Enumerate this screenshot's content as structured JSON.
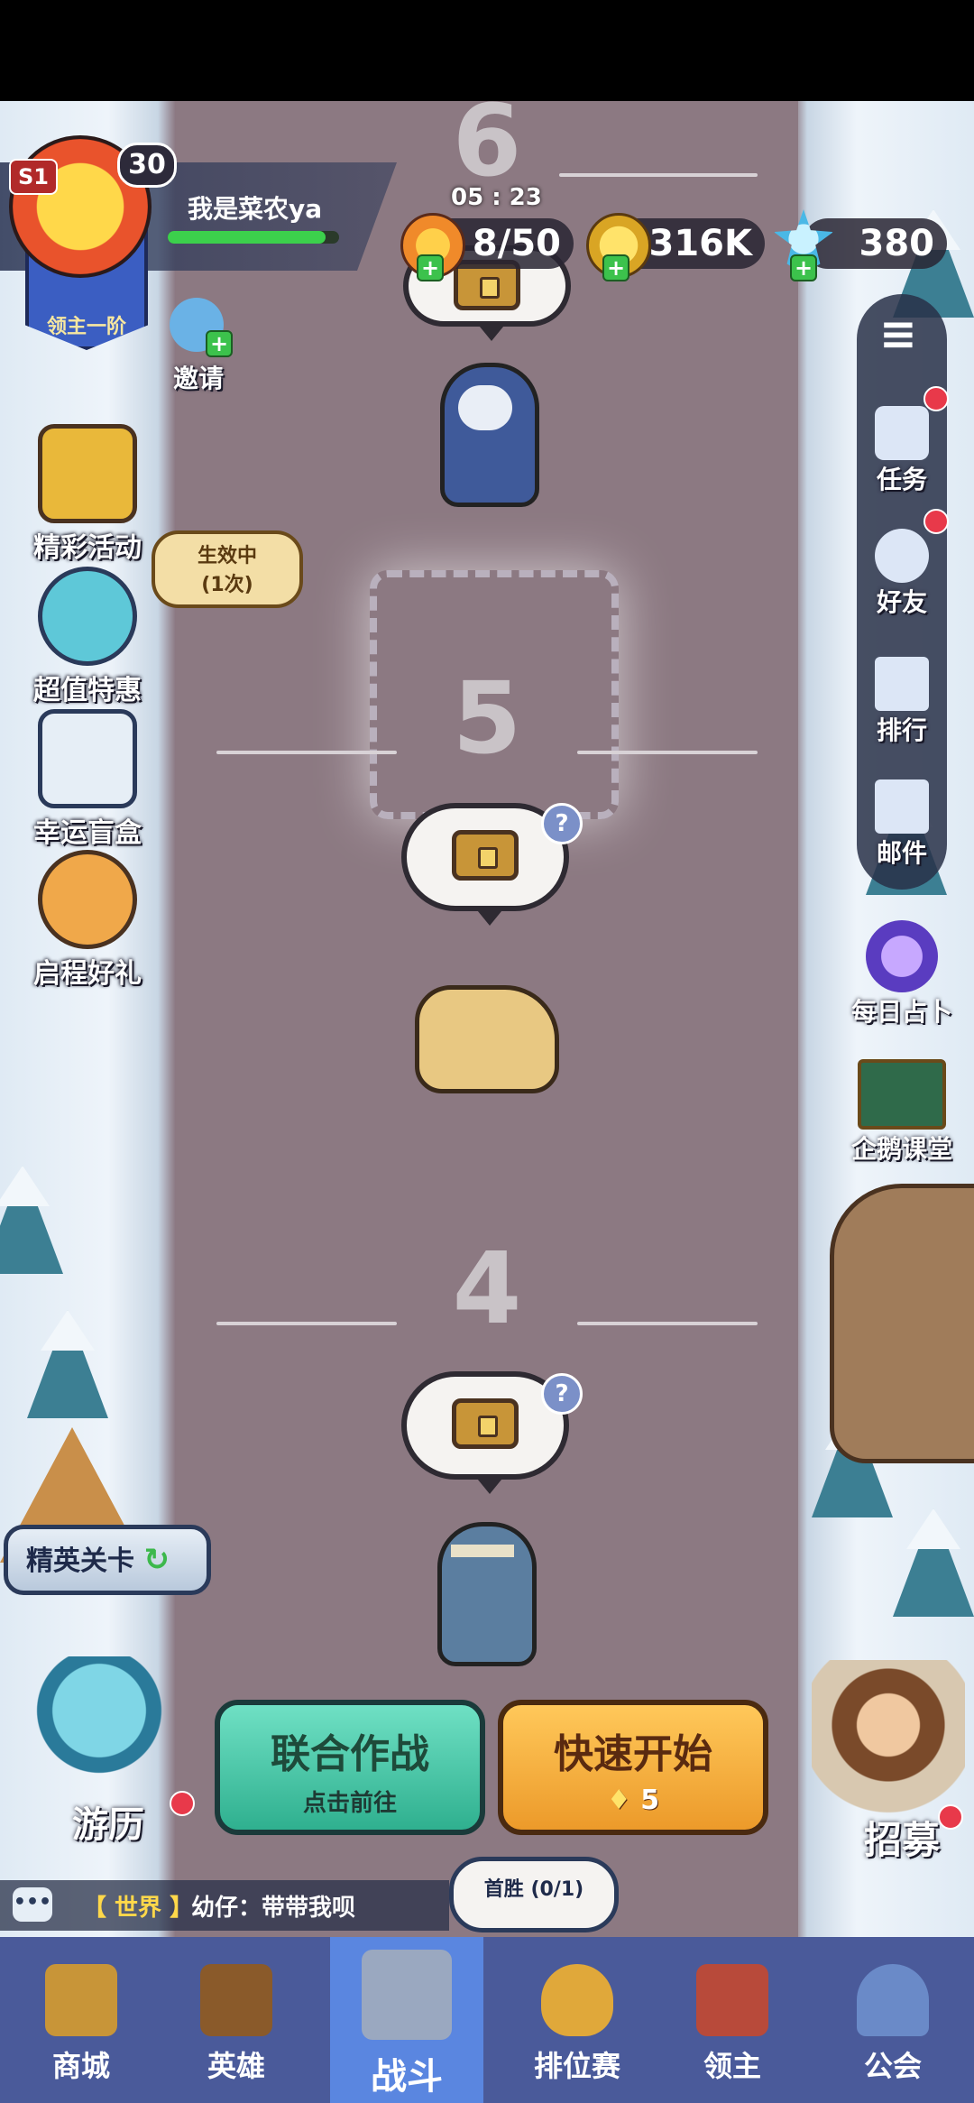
{
  "player": {
    "season": "S1",
    "level": "30",
    "name": "我是菜农ya",
    "rank": "领主一阶",
    "invite": "邀请"
  },
  "timer": "05 : 23",
  "resources": {
    "energy": "8/50",
    "gold": "316K",
    "gems": "380"
  },
  "left_menu": [
    {
      "label": "精彩活动",
      "icon": "chest-icon"
    },
    {
      "label": "超值特惠",
      "icon": "clock-icon"
    },
    {
      "label": "幸运盲盒",
      "icon": "clover-box-icon"
    },
    {
      "label": "启程好礼",
      "icon": "fox-icon"
    }
  ],
  "effect_badge": {
    "title": "生效中",
    "count": "(1次)"
  },
  "right_menu": [
    {
      "label": "任务"
    },
    {
      "label": "好友"
    },
    {
      "label": "排行"
    },
    {
      "label": "邮件"
    },
    {
      "label": "每日占卜"
    },
    {
      "label": "企鹅课堂"
    }
  ],
  "stages": [
    {
      "number": "6"
    },
    {
      "number": "5"
    },
    {
      "number": "4"
    }
  ],
  "elite": "精英关卡",
  "travel": "游历",
  "recruit": "招募",
  "coop": {
    "title": "联合作战",
    "subtitle": "点击前往"
  },
  "quick": {
    "title": "快速开始",
    "cost": "5"
  },
  "first_win": "首胜 (0/1)",
  "chat": {
    "channel": "【 世界 】",
    "message": "幼仔：带带我呗"
  },
  "nav": [
    {
      "label": "商城"
    },
    {
      "label": "英雄"
    },
    {
      "label": "战斗"
    },
    {
      "label": "排位赛"
    },
    {
      "label": "领主"
    },
    {
      "label": "公会"
    }
  ],
  "colors": {
    "accent": "#5a86e0",
    "coop": "#3fc7a8",
    "quick": "#f2a63a",
    "nav": "#4a5a9a"
  }
}
